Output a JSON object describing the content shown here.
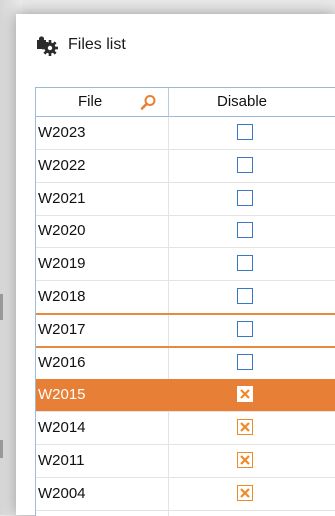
{
  "window": {
    "title": "Files list",
    "icon": "puzzle-gear-icon"
  },
  "table": {
    "columns": {
      "file": "File",
      "disable": "Disable"
    },
    "search_icon": "search-icon",
    "rows": [
      {
        "file": "W2023",
        "disabled": false
      },
      {
        "file": "W2022",
        "disabled": false
      },
      {
        "file": "W2021",
        "disabled": false
      },
      {
        "file": "W2020",
        "disabled": false
      },
      {
        "file": "W2019",
        "disabled": false
      },
      {
        "file": "W2018",
        "disabled": false
      },
      {
        "file": "W2017",
        "disabled": false
      },
      {
        "file": "W2016",
        "disabled": false
      },
      {
        "file": "W2015",
        "disabled": true
      },
      {
        "file": "W2014",
        "disabled": true
      },
      {
        "file": "W2011",
        "disabled": true
      },
      {
        "file": "W2004",
        "disabled": true
      }
    ],
    "selected_row": "W2015"
  },
  "colors": {
    "accent": "#e87f36",
    "checkbox_border": "#3b78c4",
    "check_mark": "#f08a24"
  }
}
